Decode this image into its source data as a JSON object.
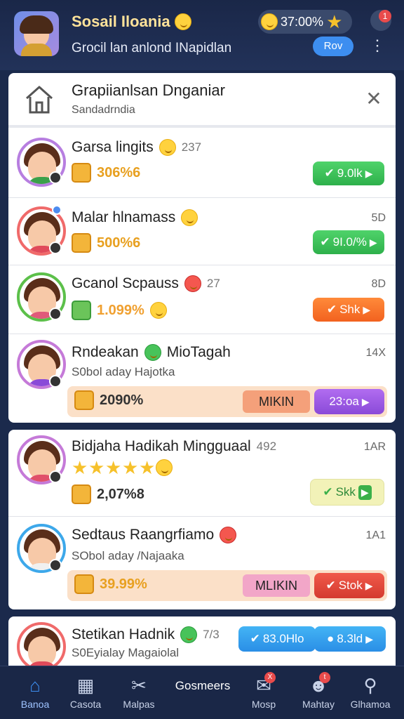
{
  "header": {
    "title": "Sosail Iloania",
    "subtitle": "Grocil lan anlond INapidlan",
    "coins": "37:00%",
    "notification_count": "1",
    "action_label": "Rov"
  },
  "card1": {
    "title": "Grapiianlsan Dnganiar",
    "subtitle": "Sandadrndia",
    "rows": [
      {
        "name": "Garsa lingits",
        "count": "237",
        "right": "",
        "score": "306%6",
        "button": "9.0lk"
      },
      {
        "name": "Malar hlnamass",
        "count": "",
        "right": "5D",
        "score": "500%6",
        "button": "9I.0/%"
      },
      {
        "name": "Gcanol Scpauss",
        "count": "27",
        "right": "8D",
        "score": "1.099%",
        "button": "Shk"
      },
      {
        "name": "Rndeakan",
        "name2": "MioTagah",
        "right": "14X",
        "sub": "S0bol aday Hajotka",
        "score": "2090%",
        "strip_label": "MIKIN",
        "button": "23:oa"
      }
    ]
  },
  "card2": {
    "rows": [
      {
        "name": "Bidjaha Hadikah Mingguaal",
        "count": "492",
        "right": "1AR",
        "score": "2,07%8",
        "button": "Skk"
      },
      {
        "name": "Sedtaus Raangrfiamo",
        "right": "1A1",
        "sub": "SObol aday /Najaaka",
        "score": "39.99%",
        "strip_label": "MLIKIN",
        "button": "Stok"
      }
    ]
  },
  "card3": {
    "rows": [
      {
        "name": "Stetikan Hadnik",
        "count": "7/3",
        "sub": "S0Eyialay Magaiolal",
        "button1": "83.0Hlo",
        "button2": "8.3ld"
      }
    ]
  },
  "navbar": {
    "items": [
      "Banoa",
      "Casota",
      "Malpas",
      "Gosmeers",
      "Mosp",
      "Mahtay",
      "Glhamoa"
    ],
    "mail_badge": "X",
    "chat_badge": "t"
  }
}
